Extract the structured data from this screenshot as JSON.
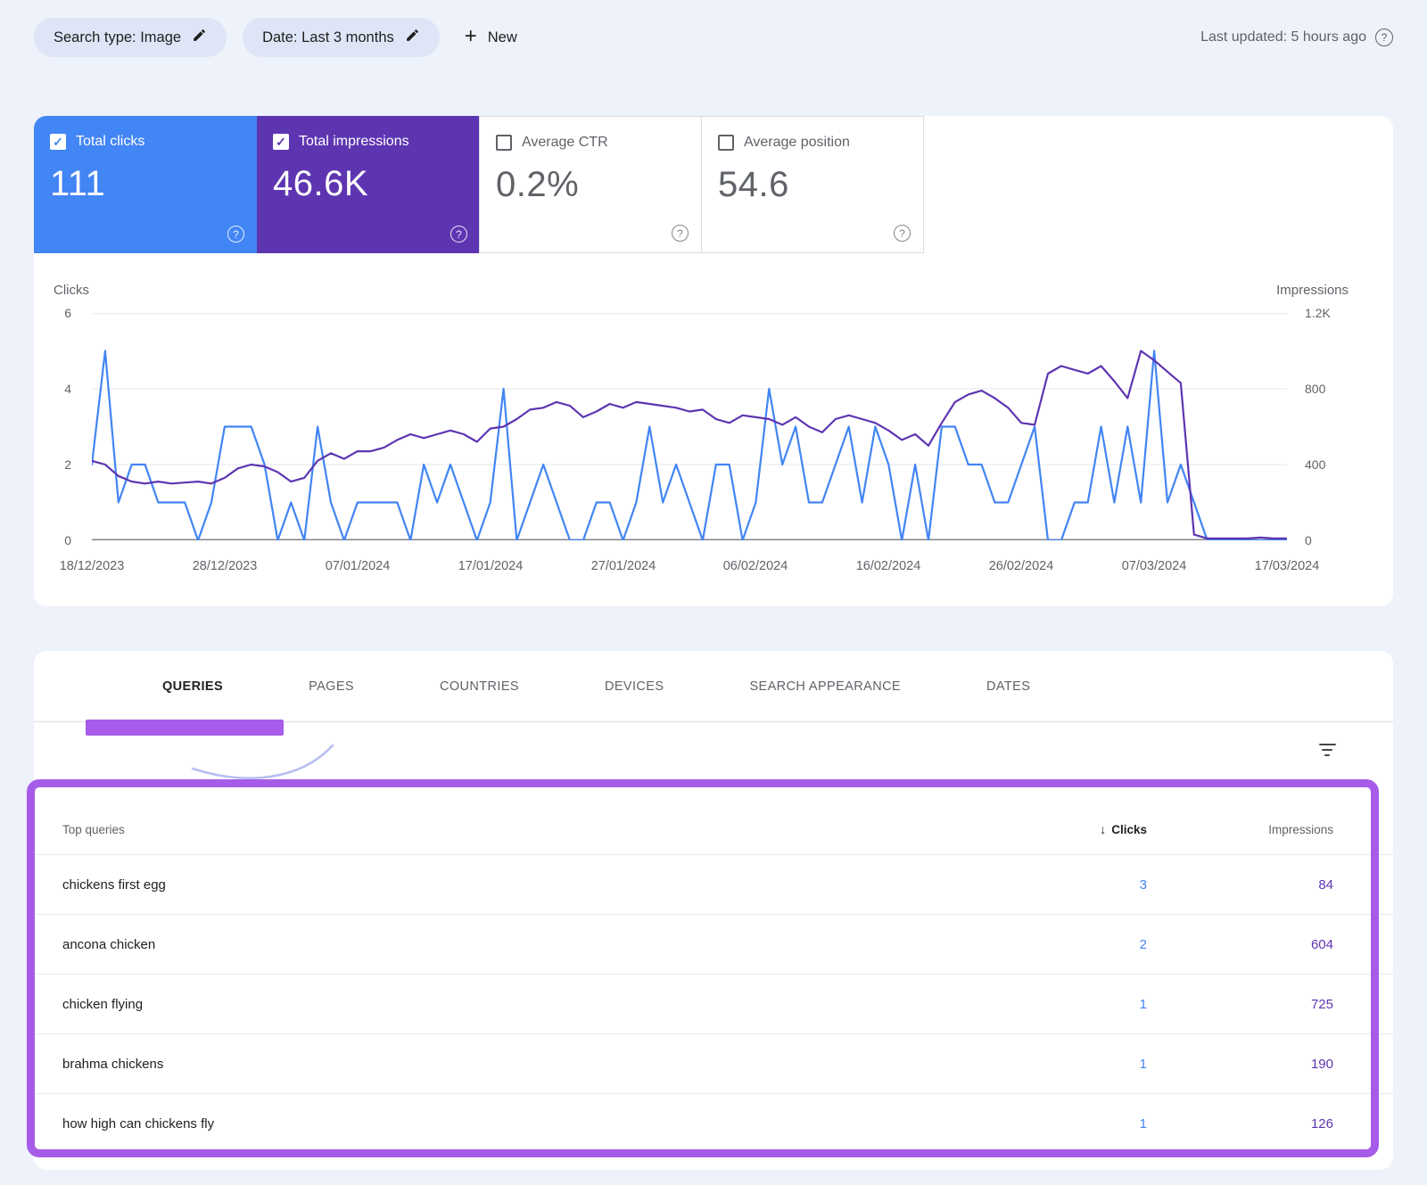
{
  "colors": {
    "blue": "#4285f4",
    "purple": "#5e35b1",
    "annotation": "#a65ce8",
    "arrow": "#b7bdf2",
    "page_bg": "#eef2fa"
  },
  "topbar": {
    "search_type_chip": "Search type: Image",
    "date_chip": "Date: Last 3 months",
    "new_button": "New",
    "last_updated": "Last updated: 5 hours ago",
    "help_glyph": "?"
  },
  "metrics": {
    "cards": [
      {
        "label": "Total clicks",
        "value": "111",
        "checked": true
      },
      {
        "label": "Total impressions",
        "value": "46.6K",
        "checked": true
      },
      {
        "label": "Average CTR",
        "value": "0.2%",
        "checked": false
      },
      {
        "label": "Average position",
        "value": "54.6",
        "checked": false
      }
    ],
    "check_glyph": "✓",
    "help_glyph": "?"
  },
  "chart_data": {
    "type": "line",
    "left_axis": {
      "label": "Clicks",
      "ticks": [
        "0",
        "2",
        "4",
        "6"
      ],
      "max": 6
    },
    "right_axis": {
      "label": "Impressions",
      "ticks": [
        "0",
        "400",
        "800",
        "1.2K"
      ],
      "max": 1200
    },
    "x_tick_labels": [
      "18/12/2023",
      "28/12/2023",
      "07/01/2024",
      "17/01/2024",
      "27/01/2024",
      "06/02/2024",
      "16/02/2024",
      "26/02/2024",
      "07/03/2024",
      "17/03/2024"
    ],
    "series": [
      {
        "name": "Clicks",
        "axis": "left",
        "color": "#4285f4",
        "values": [
          2,
          5,
          1,
          2,
          2,
          1,
          1,
          1,
          0,
          1,
          3,
          3,
          3,
          2,
          0,
          1,
          0,
          3,
          1,
          0,
          1,
          1,
          1,
          1,
          0,
          2,
          1,
          2,
          1,
          0,
          1,
          4,
          0,
          1,
          2,
          1,
          0,
          0,
          1,
          1,
          0,
          1,
          3,
          1,
          2,
          1,
          0,
          2,
          2,
          0,
          1,
          4,
          2,
          3,
          1,
          1,
          2,
          3,
          1,
          3,
          2,
          0,
          2,
          0,
          3,
          3,
          2,
          2,
          1,
          1,
          2,
          3,
          0,
          0,
          1,
          1,
          3,
          1,
          3,
          1,
          5,
          1,
          2,
          1,
          0,
          0,
          0,
          0,
          0,
          0,
          0
        ]
      },
      {
        "name": "Impressions",
        "axis": "right",
        "color": "#5e35b1",
        "values": [
          420,
          400,
          340,
          310,
          300,
          310,
          300,
          305,
          310,
          300,
          330,
          380,
          400,
          390,
          360,
          310,
          330,
          420,
          460,
          430,
          470,
          470,
          490,
          530,
          560,
          540,
          560,
          580,
          560,
          520,
          590,
          600,
          640,
          690,
          700,
          730,
          710,
          650,
          680,
          720,
          700,
          730,
          720,
          710,
          700,
          680,
          690,
          640,
          620,
          660,
          650,
          640,
          610,
          650,
          600,
          570,
          640,
          660,
          640,
          620,
          580,
          530,
          560,
          500,
          620,
          730,
          770,
          790,
          750,
          700,
          620,
          610,
          880,
          920,
          900,
          880,
          920,
          840,
          750,
          1000,
          950,
          890,
          830,
          30,
          10,
          10,
          10,
          10,
          15,
          10,
          10
        ]
      }
    ]
  },
  "tabs": [
    {
      "label": "QUERIES",
      "active": true
    },
    {
      "label": "PAGES",
      "active": false
    },
    {
      "label": "COUNTRIES",
      "active": false
    },
    {
      "label": "DEVICES",
      "active": false
    },
    {
      "label": "SEARCH APPEARANCE",
      "active": false
    },
    {
      "label": "DATES",
      "active": false
    }
  ],
  "table": {
    "header": {
      "first": "Top queries",
      "clicks": "Clicks",
      "impressions": "Impressions",
      "sort_glyph": "↓"
    },
    "rows": [
      {
        "query": "chickens first egg",
        "clicks": "3",
        "impressions": "84"
      },
      {
        "query": "ancona chicken",
        "clicks": "2",
        "impressions": "604"
      },
      {
        "query": "chicken flying",
        "clicks": "1",
        "impressions": "725"
      },
      {
        "query": "brahma chickens",
        "clicks": "1",
        "impressions": "190"
      },
      {
        "query": "how high can chickens fly",
        "clicks": "1",
        "impressions": "126"
      }
    ]
  }
}
